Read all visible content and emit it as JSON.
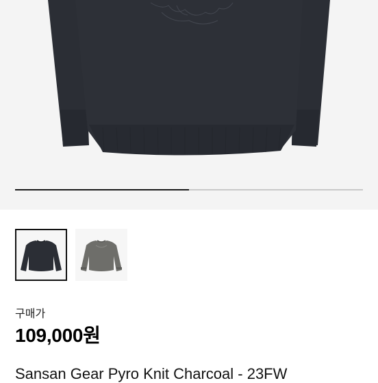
{
  "product": {
    "main_image_icon": "sweater-charcoal-image",
    "image_progress_fraction": 0.5,
    "thumbnails": [
      {
        "icon": "sweater-charcoal-thumbnail",
        "color": "#2b2e35",
        "selected": true
      },
      {
        "icon": "sweater-gray-thumbnail",
        "color": "#6e6e6a",
        "selected": false
      }
    ],
    "price_label": "구매가",
    "price": "109,000원",
    "title": "Sansan Gear Pyro Knit Charcoal - 23FW"
  },
  "colors": {
    "hero_background": "#f4f4f4",
    "sweater_charcoal": "#2b2e35",
    "sweater_gray": "#6e6e6a",
    "progress_active": "#1a1a1a",
    "progress_track": "#c9c9c9"
  }
}
